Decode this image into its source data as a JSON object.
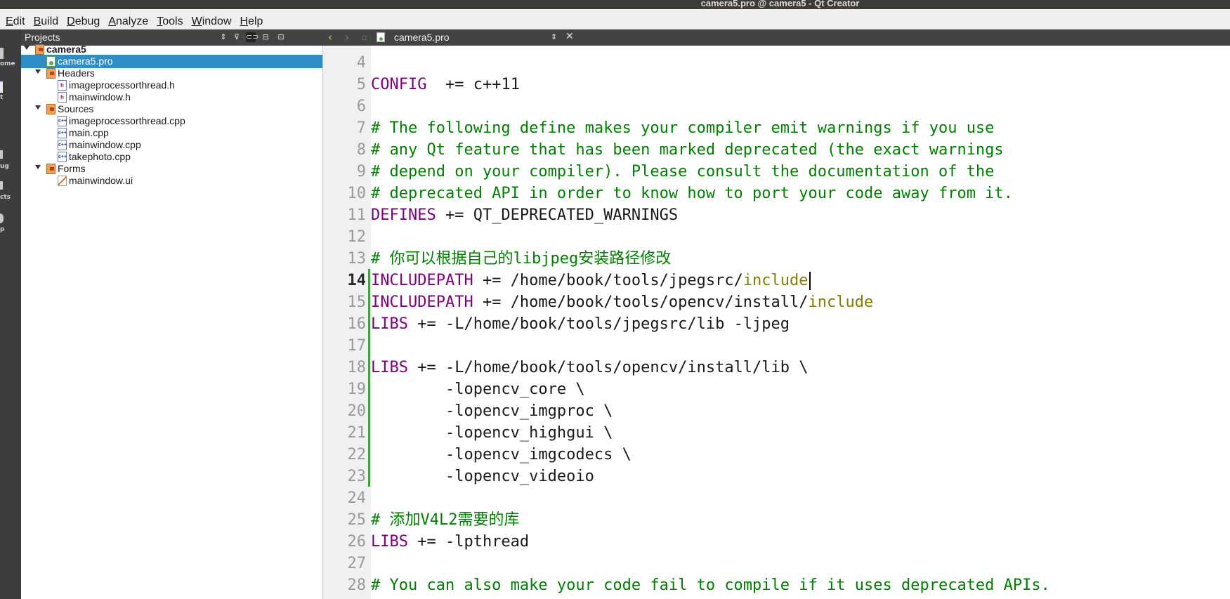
{
  "window": {
    "title": "camera5.pro @ camera5 - Qt Creator"
  },
  "menu": [
    {
      "u": "E",
      "rest": "dit"
    },
    {
      "u": "B",
      "rest": "uild"
    },
    {
      "u": "D",
      "rest": "ebug"
    },
    {
      "u": "A",
      "rest": "nalyze"
    },
    {
      "u": "T",
      "rest": "ools"
    },
    {
      "u": "W",
      "rest": "indow"
    },
    {
      "u": "H",
      "rest": "elp"
    }
  ],
  "modes": [
    "ome",
    "t",
    "ug",
    "cts",
    "p"
  ],
  "projects": {
    "header": "Projects",
    "tree": [
      {
        "label": "camera5",
        "level": 0,
        "kind": "project",
        "expanded": true,
        "bold": true
      },
      {
        "label": "camera5.pro",
        "level": 1,
        "kind": "pro",
        "selected": true
      },
      {
        "label": "Headers",
        "level": 1,
        "kind": "folder",
        "expanded": true
      },
      {
        "label": "imageprocessorthread.h",
        "level": 2,
        "kind": "h"
      },
      {
        "label": "mainwindow.h",
        "level": 2,
        "kind": "h"
      },
      {
        "label": "Sources",
        "level": 1,
        "kind": "folder",
        "expanded": true
      },
      {
        "label": "imageprocessorthread.cpp",
        "level": 2,
        "kind": "cpp"
      },
      {
        "label": "main.cpp",
        "level": 2,
        "kind": "cpp"
      },
      {
        "label": "mainwindow.cpp",
        "level": 2,
        "kind": "cpp"
      },
      {
        "label": "takephoto.cpp",
        "level": 2,
        "kind": "cpp"
      },
      {
        "label": "Forms",
        "level": 1,
        "kind": "folder",
        "expanded": true
      },
      {
        "label": "mainwindow.ui",
        "level": 2,
        "kind": "ui"
      }
    ]
  },
  "editor": {
    "file_name": "camera5.pro",
    "current_line": 14,
    "lines": [
      {
        "n": 4,
        "t": []
      },
      {
        "n": 5,
        "t": [
          [
            "kw",
            "CONFIG"
          ],
          [
            "",
            "  += c++11"
          ]
        ]
      },
      {
        "n": 6,
        "t": []
      },
      {
        "n": 7,
        "t": [
          [
            "cm",
            "# The following define makes your compiler emit warnings if you use"
          ]
        ]
      },
      {
        "n": 8,
        "t": [
          [
            "cm",
            "# any Qt feature that has been marked deprecated (the exact warnings"
          ]
        ]
      },
      {
        "n": 9,
        "t": [
          [
            "cm",
            "# depend on your compiler). Please consult the documentation of the"
          ]
        ]
      },
      {
        "n": 10,
        "t": [
          [
            "cm",
            "# deprecated API in order to know how to port your code away from it."
          ]
        ]
      },
      {
        "n": 11,
        "t": [
          [
            "kw",
            "DEFINES"
          ],
          [
            "",
            " += QT_DEPRECATED_WARNINGS"
          ]
        ]
      },
      {
        "n": 12,
        "t": []
      },
      {
        "n": 13,
        "t": [
          [
            "cm",
            "# 你可以根据自己的libjpeg安装路径修改"
          ]
        ]
      },
      {
        "n": 14,
        "t": [
          [
            "kw",
            "INCLUDEPATH"
          ],
          [
            "",
            " += /home/book/tools/jpegsrc/"
          ],
          [
            "mac",
            "include"
          ]
        ]
      },
      {
        "n": 15,
        "t": [
          [
            "kw",
            "INCLUDEPATH"
          ],
          [
            "",
            " += /home/book/tools/opencv/install/"
          ],
          [
            "mac",
            "include"
          ]
        ]
      },
      {
        "n": 16,
        "t": [
          [
            "kw",
            "LIBS"
          ],
          [
            "",
            " += -L/home/book/tools/jpegsrc/lib -ljpeg"
          ]
        ]
      },
      {
        "n": 17,
        "t": []
      },
      {
        "n": 18,
        "t": [
          [
            "kw",
            "LIBS"
          ],
          [
            "",
            " += -L/home/book/tools/opencv/install/lib \\"
          ]
        ]
      },
      {
        "n": 19,
        "t": [
          [
            "",
            "        -lopencv_core \\"
          ]
        ]
      },
      {
        "n": 20,
        "t": [
          [
            "",
            "        -lopencv_imgproc \\"
          ]
        ]
      },
      {
        "n": 21,
        "t": [
          [
            "",
            "        -lopencv_highgui \\"
          ]
        ]
      },
      {
        "n": 22,
        "t": [
          [
            "",
            "        -lopencv_imgcodecs \\"
          ]
        ]
      },
      {
        "n": 23,
        "t": [
          [
            "",
            "        -lopencv_videoio"
          ]
        ]
      },
      {
        "n": 24,
        "t": []
      },
      {
        "n": 25,
        "t": [
          [
            "cm",
            "# 添加V4L2需要的库"
          ]
        ]
      },
      {
        "n": 26,
        "t": [
          [
            "kw",
            "LIBS"
          ],
          [
            "",
            " += -lpthread"
          ]
        ]
      },
      {
        "n": 27,
        "t": []
      },
      {
        "n": 28,
        "t": [
          [
            "cm",
            "# You can also make your code fail to compile if it uses deprecated APIs."
          ]
        ]
      }
    ]
  }
}
